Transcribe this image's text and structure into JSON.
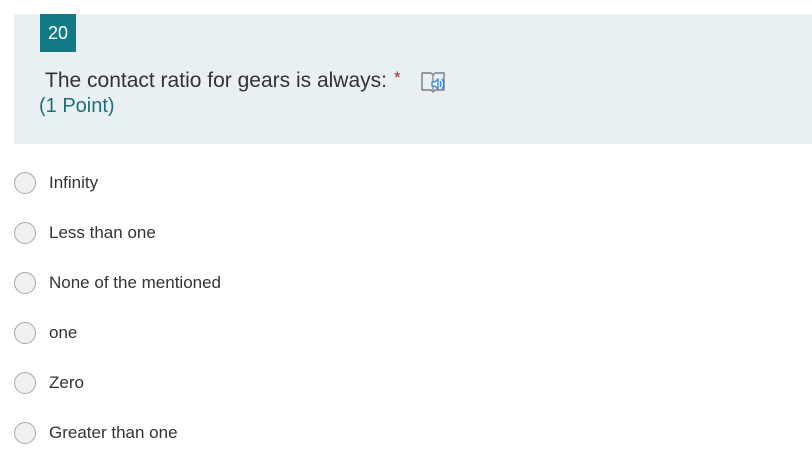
{
  "question": {
    "number": "20",
    "text": "The contact ratio for gears is always:",
    "required_marker": "*",
    "points": "(1 Point)",
    "reader_icon": "immersive-reader-icon"
  },
  "options": [
    {
      "label": "Infinity"
    },
    {
      "label": "Less than one"
    },
    {
      "label": "None of the mentioned"
    },
    {
      "label": "one"
    },
    {
      "label": "Zero"
    },
    {
      "label": "Greater than one"
    }
  ],
  "colors": {
    "accent": "#117a84",
    "card_background": "#e9f0f3",
    "required": "#a4262c",
    "points_text": "#1e6f77"
  }
}
